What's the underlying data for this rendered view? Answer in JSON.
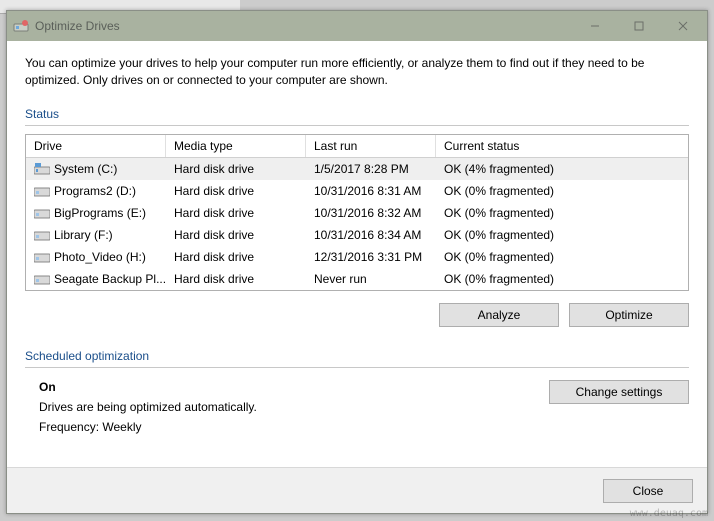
{
  "window": {
    "title": "Optimize Drives",
    "description": "You can optimize your drives to help your computer run more efficiently, or analyze them to find out if they need to be optimized. Only drives on or connected to your computer are shown."
  },
  "status": {
    "heading": "Status",
    "columns": {
      "drive": "Drive",
      "media": "Media type",
      "lastrun": "Last run",
      "status": "Current status"
    },
    "rows": [
      {
        "name": "System (C:)",
        "media": "Hard disk drive",
        "lastrun": "1/5/2017 8:28 PM",
        "status": "OK (4% fragmented)",
        "selected": true,
        "iconType": "system"
      },
      {
        "name": "Programs2 (D:)",
        "media": "Hard disk drive",
        "lastrun": "10/31/2016 8:31 AM",
        "status": "OK (0% fragmented)",
        "selected": false,
        "iconType": "drive"
      },
      {
        "name": "BigPrograms (E:)",
        "media": "Hard disk drive",
        "lastrun": "10/31/2016 8:32 AM",
        "status": "OK (0% fragmented)",
        "selected": false,
        "iconType": "drive"
      },
      {
        "name": "Library (F:)",
        "media": "Hard disk drive",
        "lastrun": "10/31/2016 8:34 AM",
        "status": "OK (0% fragmented)",
        "selected": false,
        "iconType": "drive"
      },
      {
        "name": "Photo_Video (H:)",
        "media": "Hard disk drive",
        "lastrun": "12/31/2016 3:31 PM",
        "status": "OK (0% fragmented)",
        "selected": false,
        "iconType": "drive"
      },
      {
        "name": "Seagate Backup Pl...",
        "media": "Hard disk drive",
        "lastrun": "Never run",
        "status": "OK (0% fragmented)",
        "selected": false,
        "iconType": "drive"
      }
    ]
  },
  "buttons": {
    "analyze": "Analyze",
    "optimize": "Optimize",
    "change_settings": "Change settings",
    "close": "Close"
  },
  "schedule": {
    "heading": "Scheduled optimization",
    "state": "On",
    "line1": "Drives are being optimized automatically.",
    "line2": "Frequency: Weekly"
  },
  "watermark": "www.deuaq.com"
}
